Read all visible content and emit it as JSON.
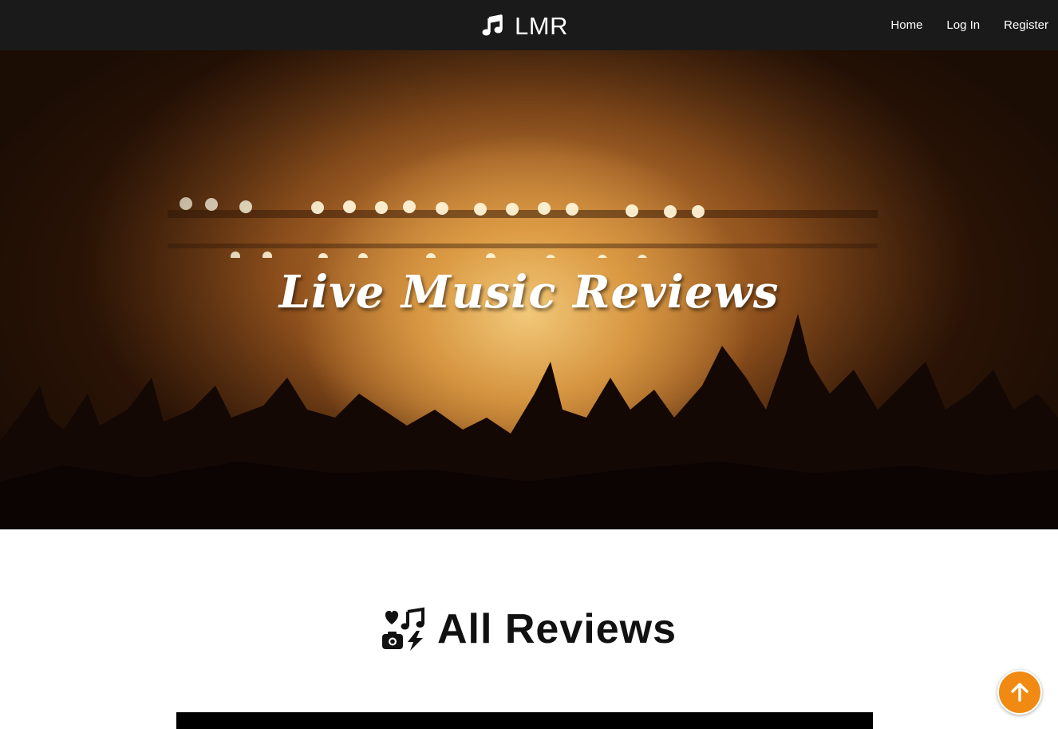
{
  "navbar": {
    "brand": {
      "text": "LMR",
      "icon": "music-note-icon"
    },
    "links": [
      {
        "label": "Home"
      },
      {
        "label": "Log In"
      },
      {
        "label": "Register"
      }
    ]
  },
  "hero": {
    "title": "Live Music Reviews",
    "background": "concert-crowd-image"
  },
  "reviews": {
    "heading": "All Reviews",
    "icon": "icons-collection-icon"
  },
  "back_to_top": {
    "icon": "arrow-up-icon"
  },
  "colors": {
    "navbar_bg": "#1a1a1a",
    "accent": "#f08a12",
    "text_dark": "#111111"
  }
}
